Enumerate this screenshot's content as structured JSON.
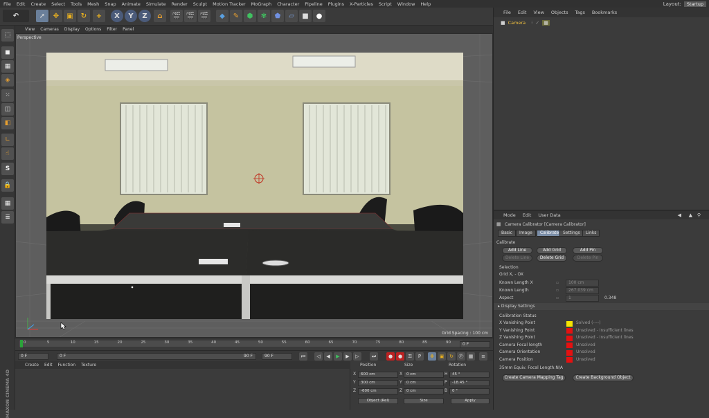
{
  "menubar": {
    "items": [
      "File",
      "Edit",
      "Create",
      "Select",
      "Tools",
      "Mesh",
      "Snap",
      "Animate",
      "Simulate",
      "Render",
      "Sculpt",
      "Motion Tracker",
      "MoGraph",
      "Character",
      "Pipeline",
      "Plugins",
      "X-Particles",
      "Script",
      "Window",
      "Help"
    ],
    "layout_label": "Layout:",
    "layout_value": "Startup"
  },
  "toolbar": {
    "undo_icon": "↶",
    "axis_x": "X",
    "axis_y": "Y",
    "axis_z": "Z"
  },
  "viewport": {
    "menu": [
      "View",
      "Cameras",
      "Display",
      "Options",
      "Filter",
      "Panel"
    ],
    "camera_label": "Perspective",
    "grid_spacing": "Grid Spacing : 100 cm"
  },
  "timeline": {
    "ticks": [
      "0",
      "5",
      "10",
      "15",
      "20",
      "25",
      "30",
      "35",
      "40",
      "45",
      "50",
      "55",
      "60",
      "65",
      "70",
      "75",
      "80",
      "85",
      "90"
    ],
    "current_frame": "0 F",
    "start_field": "0 F",
    "min_field": "0 F",
    "range_end": "90 F",
    "end_field": "90 F"
  },
  "material": {
    "menu": [
      "Create",
      "Edit",
      "Function",
      "Texture"
    ]
  },
  "coordinates": {
    "headers": {
      "position": "Position",
      "size": "Size",
      "rotation": "Rotation"
    },
    "rows": [
      {
        "axis": "X",
        "pos": "600 cm",
        "size_axis": "X",
        "size": "0 cm",
        "rot_axis": "H",
        "rot": "45 °"
      },
      {
        "axis": "Y",
        "pos": "300 cm",
        "size_axis": "Y",
        "size": "0 cm",
        "rot_axis": "P",
        "rot": "-18.45 °"
      },
      {
        "axis": "Z",
        "pos": "-600 cm",
        "size_axis": "Z",
        "size": "0 cm",
        "rot_axis": "B",
        "rot": "0 °"
      }
    ],
    "mode_select": "Object (Rel)",
    "size_select": "Size",
    "apply_button": "Apply"
  },
  "objects": {
    "menu": [
      "File",
      "Edit",
      "View",
      "Objects",
      "Tags",
      "Bookmarks"
    ],
    "items": [
      {
        "name": "Camera"
      }
    ]
  },
  "attributes": {
    "menu": [
      "Mode",
      "Edit",
      "User Data"
    ],
    "title": "Camera Calibrator [Camera Calibrator]",
    "tabs": [
      "Basic",
      "Image",
      "Calibrate",
      "Settings",
      "Links"
    ],
    "active_tab": "Calibrate",
    "section_calibrate": "Calibrate",
    "btn_add_line": "Add Line",
    "btn_add_grid": "Add Grid",
    "btn_add_pin": "Add Pin",
    "btn_delete_line": "Delete Line",
    "btn_delete_grid": "Delete Grid",
    "btn_delete_pin": "Delete Pin",
    "selection_label": "Selection",
    "selection_value": "Grid X, - OX",
    "known_length_x_label": "Known Length X",
    "known_length_x_value": "100 cm",
    "known_length_label": "Known Length",
    "known_length_value": "267.039 cm",
    "aspect_label": "Aspect",
    "aspect_field": "1",
    "aspect_value": "0.348",
    "display_settings": "▸ Display Settings",
    "status_title": "Calibration Status",
    "status_rows": [
      {
        "label": "X Vanishing Point",
        "color": "#f5e400",
        "text": "Solved (----)"
      },
      {
        "label": "Y Vanishing Point",
        "color": "#e51010",
        "text": "Unsolved - Insufficient lines"
      },
      {
        "label": "Z Vanishing Point",
        "color": "#e51010",
        "text": "Unsolved - Insufficient lines"
      },
      {
        "label": "Camera Focal length",
        "color": "#e51010",
        "text": "Unsolved"
      },
      {
        "label": "Camera Orientation",
        "color": "#e51010",
        "text": "Unsolved"
      },
      {
        "label": "Camera Position",
        "color": "#e51010",
        "text": "Unsolved"
      }
    ],
    "focal_equiv": "35mm Equiv. Focal Length:N/A",
    "btn_mapping_tag": "Create Camera Mapping Tag",
    "btn_background": "Create Background Object"
  },
  "brand": "MAXON CINEMA 4D"
}
